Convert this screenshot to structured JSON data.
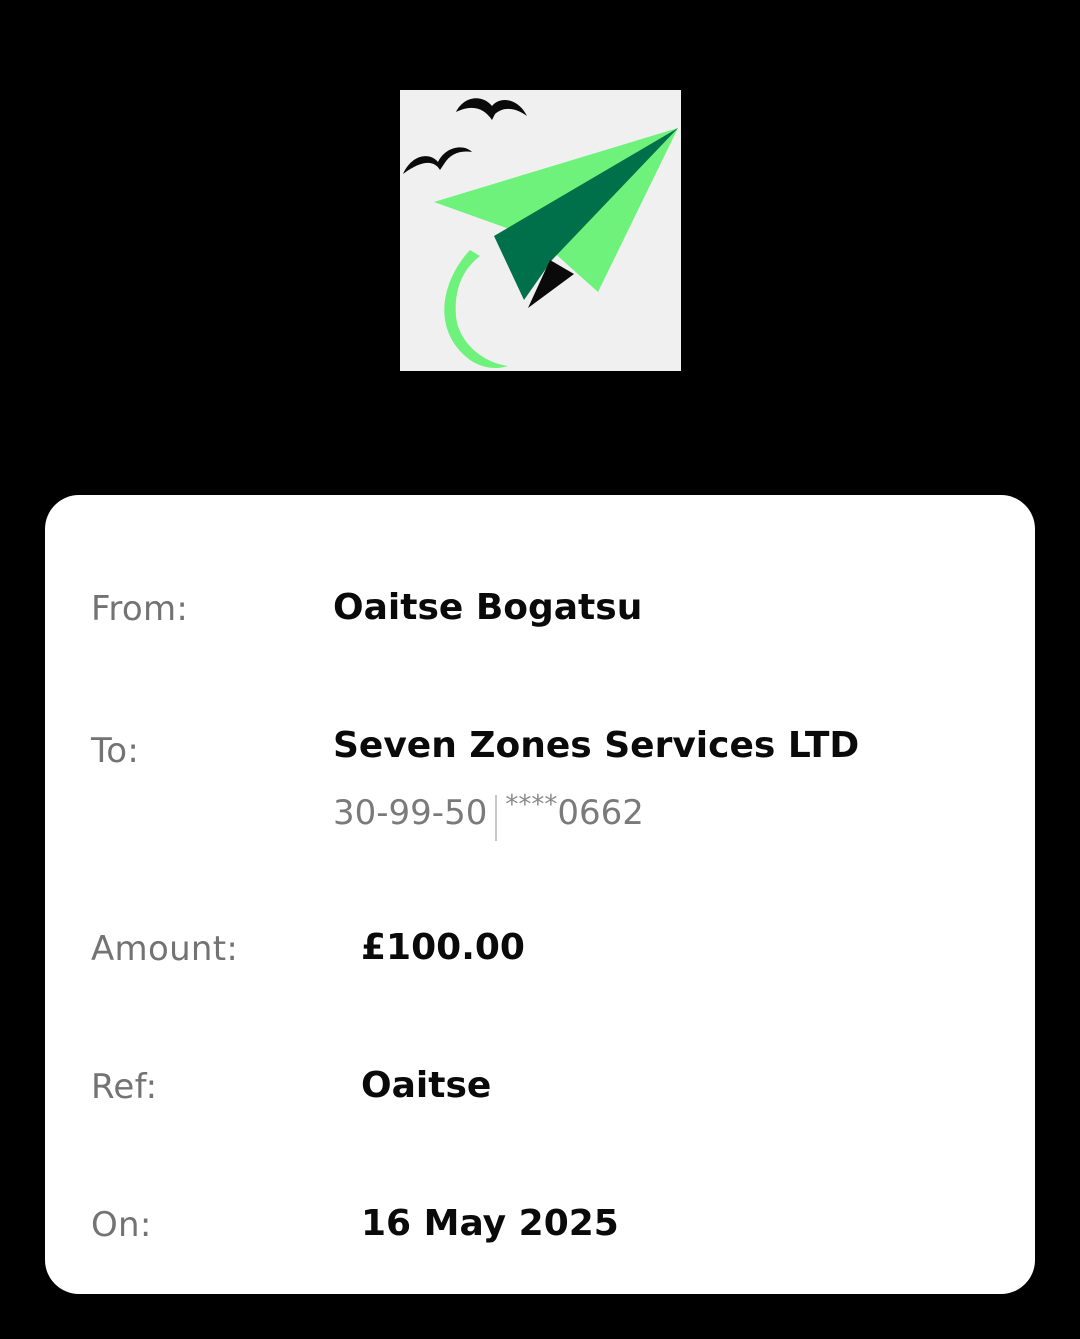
{
  "logo": {
    "icon": "paper-plane-logo",
    "colors": {
      "light_green": "#6ef27b",
      "dark_green": "#00704a",
      "background": "#f0f0f0"
    }
  },
  "fields": {
    "from": {
      "label": "From:",
      "value": "Oaitse Bogatsu"
    },
    "to": {
      "label": "To:",
      "value": "Seven Zones Services LTD",
      "sort_code": "30-99-50",
      "account_mask": "****",
      "account_last4": "0662"
    },
    "amount": {
      "label": "Amount:",
      "value": "£100.00"
    },
    "ref": {
      "label": "Ref:",
      "value": "Oaitse"
    },
    "on": {
      "label": "On:",
      "value": "16 May 2025"
    }
  }
}
